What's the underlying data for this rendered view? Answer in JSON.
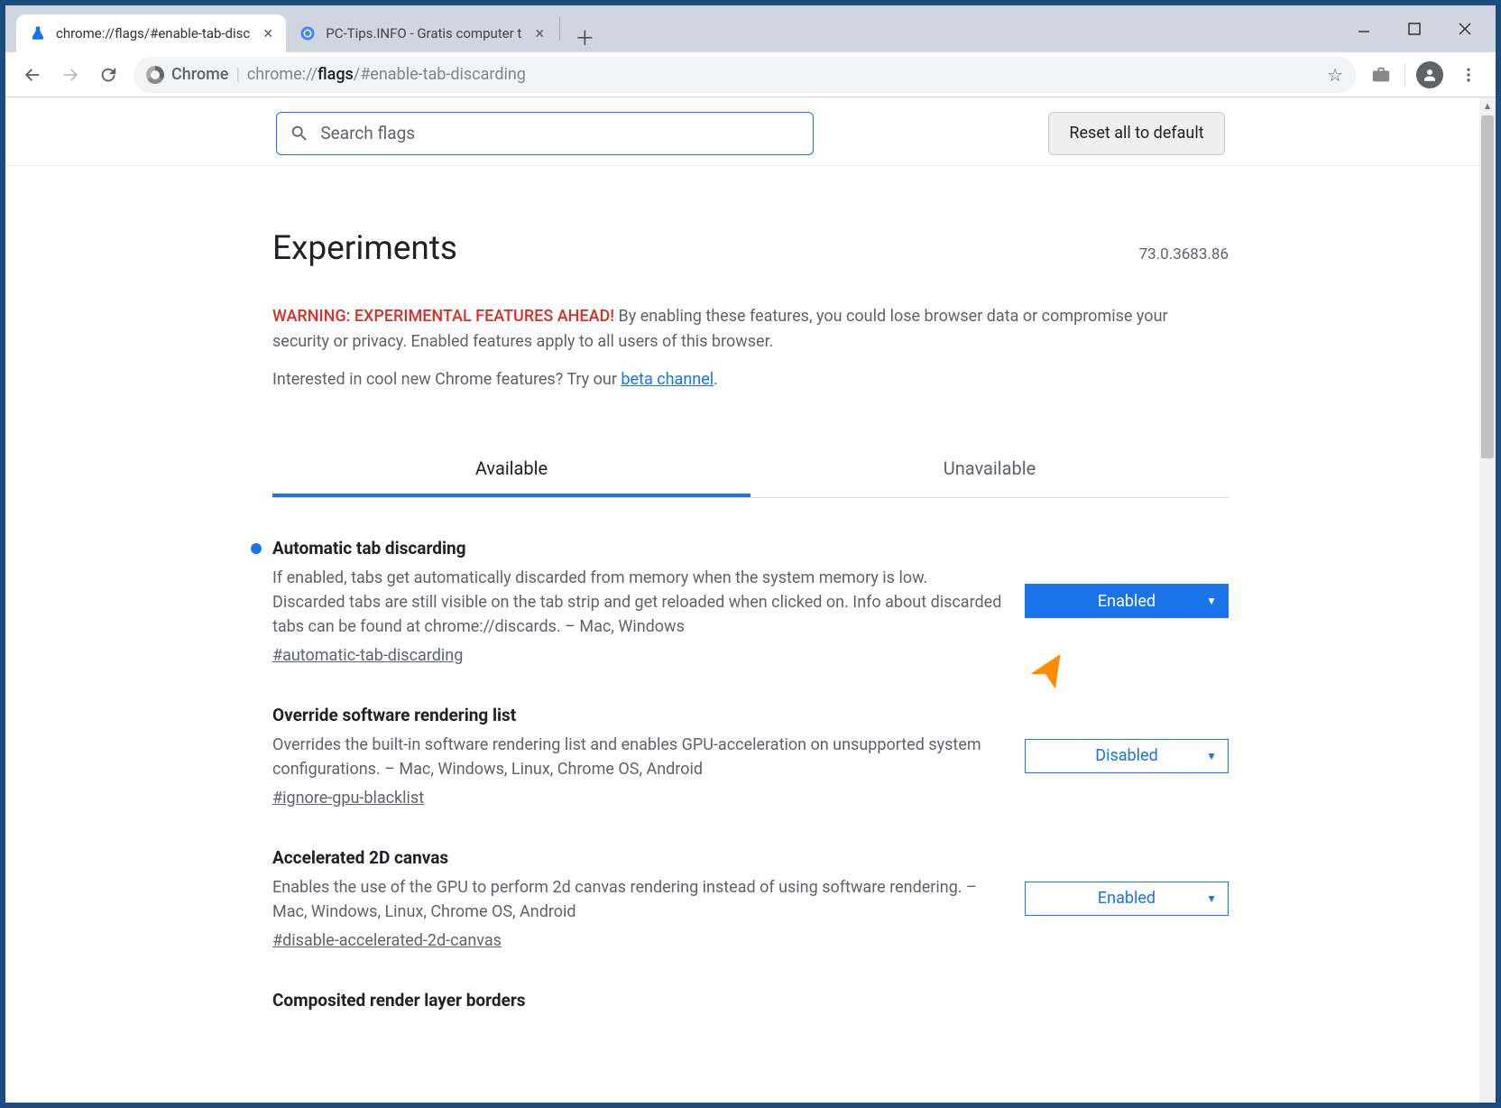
{
  "tabs": [
    {
      "title": "chrome://flags/#enable-tab-disc",
      "active": true
    },
    {
      "title": "PC-Tips.INFO - Gratis computer t",
      "active": false
    }
  ],
  "omnibox": {
    "label": "Chrome",
    "url_prefix": "chrome://",
    "url_bold": "flags",
    "url_suffix": "/#enable-tab-discarding"
  },
  "flags_page": {
    "search_placeholder": "Search flags",
    "reset_label": "Reset all to default",
    "heading": "Experiments",
    "version": "73.0.3683.86",
    "warning_label": "WARNING: EXPERIMENTAL FEATURES AHEAD!",
    "warning_text": " By enabling these features, you could lose browser data or compromise your security or privacy. Enabled features apply to all users of this browser.",
    "beta_prefix": "Interested in cool new Chrome features? Try our ",
    "beta_link": "beta channel",
    "beta_suffix": ".",
    "tab_available": "Available",
    "tab_unavailable": "Unavailable",
    "items": [
      {
        "title": "Automatic tab discarding",
        "desc": "If enabled, tabs get automatically discarded from memory when the system memory is low. Discarded tabs are still visible on the tab strip and get reloaded when clicked on. Info about discarded tabs can be found at chrome://discards. – Mac, Windows",
        "hash": "#automatic-tab-discarding",
        "value": "Enabled",
        "primary": true,
        "dot": true
      },
      {
        "title": "Override software rendering list",
        "desc": "Overrides the built-in software rendering list and enables GPU-acceleration on unsupported system configurations. – Mac, Windows, Linux, Chrome OS, Android",
        "hash": "#ignore-gpu-blacklist",
        "value": "Disabled",
        "primary": false,
        "dot": false
      },
      {
        "title": "Accelerated 2D canvas",
        "desc": "Enables the use of the GPU to perform 2d canvas rendering instead of using software rendering. – Mac, Windows, Linux, Chrome OS, Android",
        "hash": "#disable-accelerated-2d-canvas",
        "value": "Enabled",
        "primary": false,
        "dot": false
      },
      {
        "title": "Composited render layer borders",
        "desc": "",
        "hash": "",
        "value": "",
        "primary": false,
        "dot": false
      }
    ]
  }
}
